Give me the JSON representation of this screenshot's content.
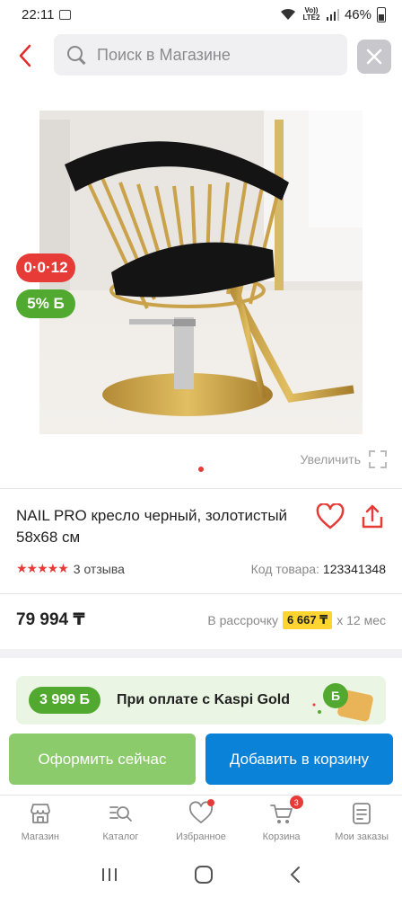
{
  "status_bar": {
    "time": "22:11",
    "network": "Vo)) LTE2",
    "battery": "46%"
  },
  "search": {
    "placeholder": "Поиск в Магазине"
  },
  "product": {
    "badge_installment": "0·0·12",
    "badge_bonus": "5% Б",
    "zoom_label": "Увеличить",
    "title": "NAIL PRO кресло черный, золотистый 58x68 см",
    "rating": 4.5,
    "reviews": "3 отзыва",
    "code_label": "Код товара:",
    "code_value": "123341348",
    "price": "79 994 ₸",
    "installment_prefix": "В рассрочку",
    "installment_amount": "6 667 ₸",
    "installment_suffix": "х 12 мес"
  },
  "promo": {
    "amount": "3 999 Б",
    "text": "При оплате с Kaspi Gold"
  },
  "actions": {
    "buy_now": "Оформить сейчас",
    "add_to_cart": "Добавить в корзину"
  },
  "bottom_nav": [
    {
      "label": "Магазин",
      "icon": "store-icon"
    },
    {
      "label": "Каталог",
      "icon": "catalog-icon"
    },
    {
      "label": "Избранное",
      "icon": "heart-icon"
    },
    {
      "label": "Корзина",
      "icon": "cart-icon",
      "badge": "3"
    },
    {
      "label": "Мои заказы",
      "icon": "orders-icon"
    }
  ],
  "colors": {
    "accent_red": "#e63b36",
    "bonus_green": "#52a92f",
    "cart_blue": "#0a82d8",
    "buy_green": "#8ccb6b",
    "installment_yellow": "#fed530"
  }
}
